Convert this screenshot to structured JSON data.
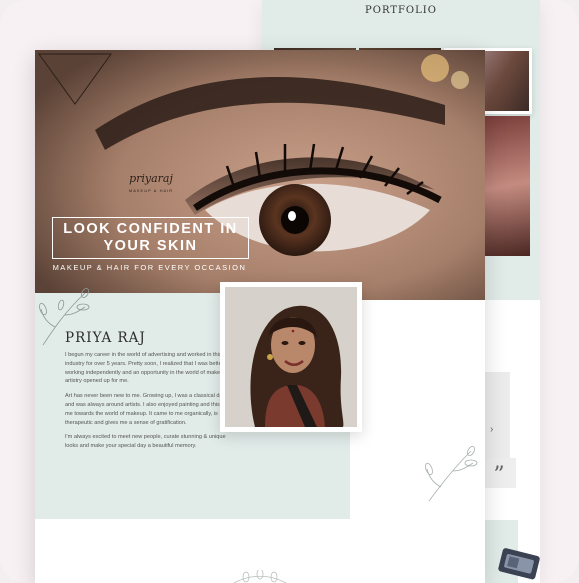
{
  "portfolio": {
    "title": "PORTFOLIO"
  },
  "hero": {
    "logo_name": "priyaraj",
    "logo_sub": "MAKEUP & HAIR",
    "headline": "LOOK CONFIDENT IN YOUR SKIN",
    "tagline": "MAKEUP & HAIR FOR EVERY OCCASION"
  },
  "about": {
    "name": "PRIYA RAJ",
    "paragraphs": [
      "I begun my career in the world of advertising and worked in this industry for over 5 years. Pretty soon, I realized that I was better off working independently and an opportunity in the world of makeup artistry opened up for me.",
      "Art has never been new to me. Growing up, I was a classical dancer and was always around artists. I also enjoyed painting and this drew me towards the world of makeup. It came to me organically, is therapeutic and gives me a sense of gratification.",
      "I'm always excited to meet new people, curate stunning & unique looks and make your special day a beautiful memory."
    ]
  },
  "colors": {
    "mint": "#e1ebe8",
    "background": "#f8f1f3",
    "text": "#2d2d2d"
  },
  "icons": {
    "gallery_arrow": "chevron-right-icon",
    "testimonial": "quote-icon",
    "floral": "floral-sprig-icon",
    "logo_mark": "triangle-logo-icon"
  }
}
